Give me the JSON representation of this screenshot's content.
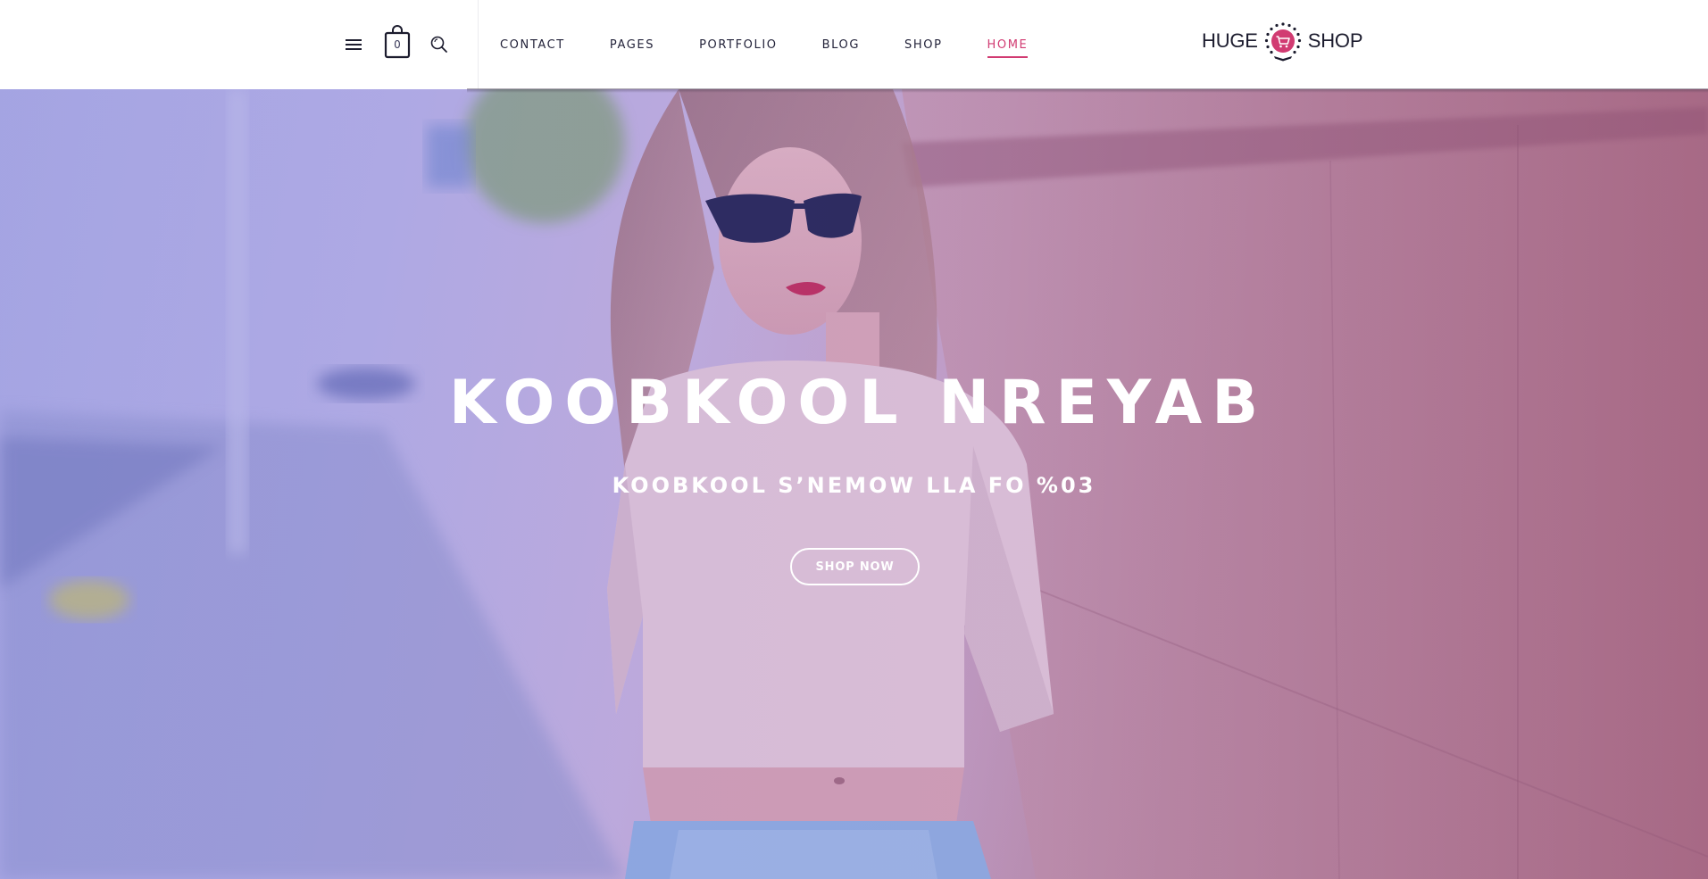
{
  "header": {
    "cart_count": "0",
    "nav": [
      {
        "label": "CONTACT",
        "active": false
      },
      {
        "label": "PAGES",
        "active": false
      },
      {
        "label": "PORTFOLIO",
        "active": false
      },
      {
        "label": "BLOG",
        "active": false
      },
      {
        "label": "SHOP",
        "active": false
      },
      {
        "label": "HOME",
        "active": true
      }
    ],
    "logo": {
      "left": "HUGE",
      "right": "SHOP"
    },
    "icons": {
      "menu": "hamburger-menu-icon",
      "cart": "shopping-bag-icon",
      "search": "search-icon",
      "logo": "shopping-cart-laurel-emblem"
    }
  },
  "hero": {
    "title": "KOOBKOOL NREYAB",
    "subtitle": "KOOBKOOL S’NEMOW LLA FO %03",
    "button_label": "SHOP NOW"
  },
  "colors": {
    "accent": "#d13b72",
    "text_dark": "#1c1c2e",
    "hero_text": "#ffffff"
  }
}
